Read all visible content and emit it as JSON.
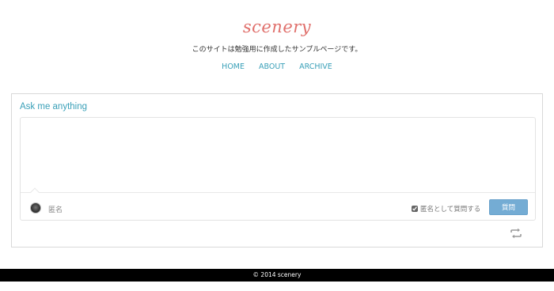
{
  "header": {
    "logo": "scenery",
    "tagline": "このサイトは勉強用に作成したサンプルページです。",
    "nav": [
      "HOME",
      "ABOUT",
      "ARCHIVE"
    ]
  },
  "ask": {
    "title": "Ask me anything",
    "input_value": "",
    "user_label": "匿名",
    "anonymous_label": "匿名として質問する",
    "anonymous_checked": true,
    "submit_label": "質問",
    "shuffle_icon": "shuffle-icon"
  },
  "footer": {
    "copyright": "© 2014 scenery"
  },
  "colors": {
    "logo": "#e0706c",
    "accent": "#3aa0b8",
    "button": "#74acd4",
    "footer_bg": "#000000"
  }
}
